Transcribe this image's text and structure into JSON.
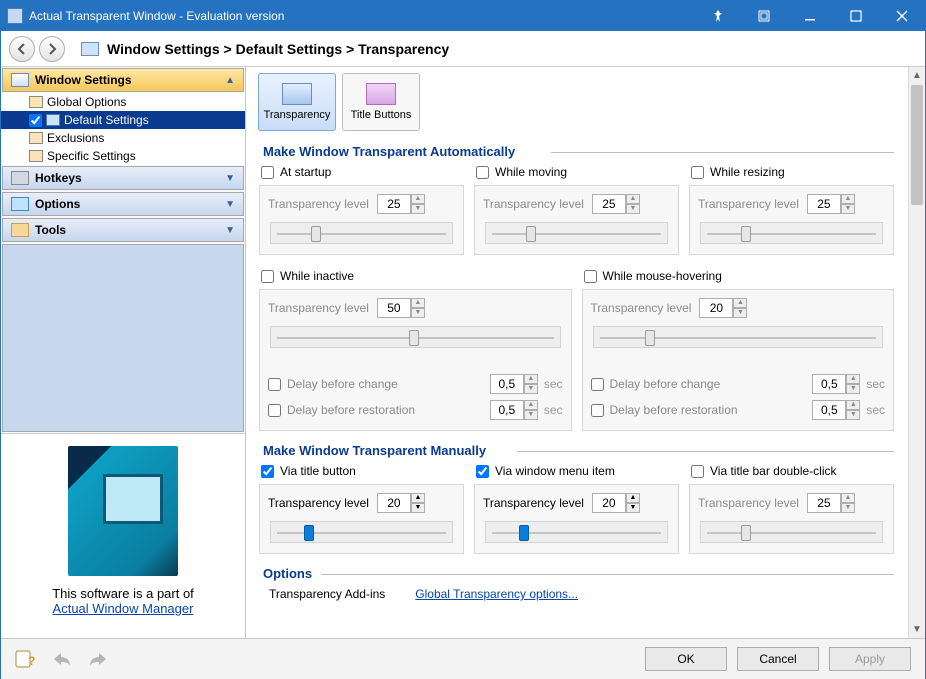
{
  "window": {
    "title": "Actual Transparent Window - Evaluation version"
  },
  "breadcrumb": "Window Settings > Default Settings > Transparency",
  "sidebar": {
    "sections": [
      {
        "label": "Window Settings",
        "expanded": true
      },
      {
        "label": "Hotkeys",
        "expanded": false
      },
      {
        "label": "Options",
        "expanded": false
      },
      {
        "label": "Tools",
        "expanded": false
      }
    ],
    "tree": [
      {
        "label": "Global Options"
      },
      {
        "label": "Default Settings"
      },
      {
        "label": "Exclusions"
      },
      {
        "label": "Specific Settings"
      }
    ]
  },
  "promo": {
    "line1": "This software is a part of",
    "link": "Actual Window Manager"
  },
  "tabs": [
    {
      "label": "Transparency"
    },
    {
      "label": "Title Buttons"
    }
  ],
  "auto": {
    "title": "Make Window Transparent Automatically",
    "startup": {
      "label": "At startup",
      "lvl_label": "Transparency level",
      "value": "25"
    },
    "moving": {
      "label": "While moving",
      "lvl_label": "Transparency level",
      "value": "25"
    },
    "resizing": {
      "label": "While resizing",
      "lvl_label": "Transparency level",
      "value": "25"
    },
    "inactive": {
      "label": "While inactive",
      "lvl_label": "Transparency level",
      "value": "50",
      "delay_change": {
        "label": "Delay before change",
        "value": "0,5",
        "unit": "sec"
      },
      "delay_restore": {
        "label": "Delay before restoration",
        "value": "0,5",
        "unit": "sec"
      }
    },
    "hover": {
      "label": "While mouse-hovering",
      "lvl_label": "Transparency level",
      "value": "20",
      "delay_change": {
        "label": "Delay before change",
        "value": "0,5",
        "unit": "sec"
      },
      "delay_restore": {
        "label": "Delay before restoration",
        "value": "0,5",
        "unit": "sec"
      }
    }
  },
  "manual": {
    "title": "Make Window Transparent Manually",
    "title_btn": {
      "label": "Via title button",
      "lvl_label": "Transparency level",
      "value": "20"
    },
    "menu_item": {
      "label": "Via window menu item",
      "lvl_label": "Transparency level",
      "value": "20"
    },
    "dbl_click": {
      "label": "Via title bar double-click",
      "lvl_label": "Transparency level",
      "value": "25"
    }
  },
  "options": {
    "title": "Options",
    "addins": "Transparency Add-ins",
    "global_link": "Global Transparency options..."
  },
  "footer": {
    "ok": "OK",
    "cancel": "Cancel",
    "apply": "Apply"
  }
}
